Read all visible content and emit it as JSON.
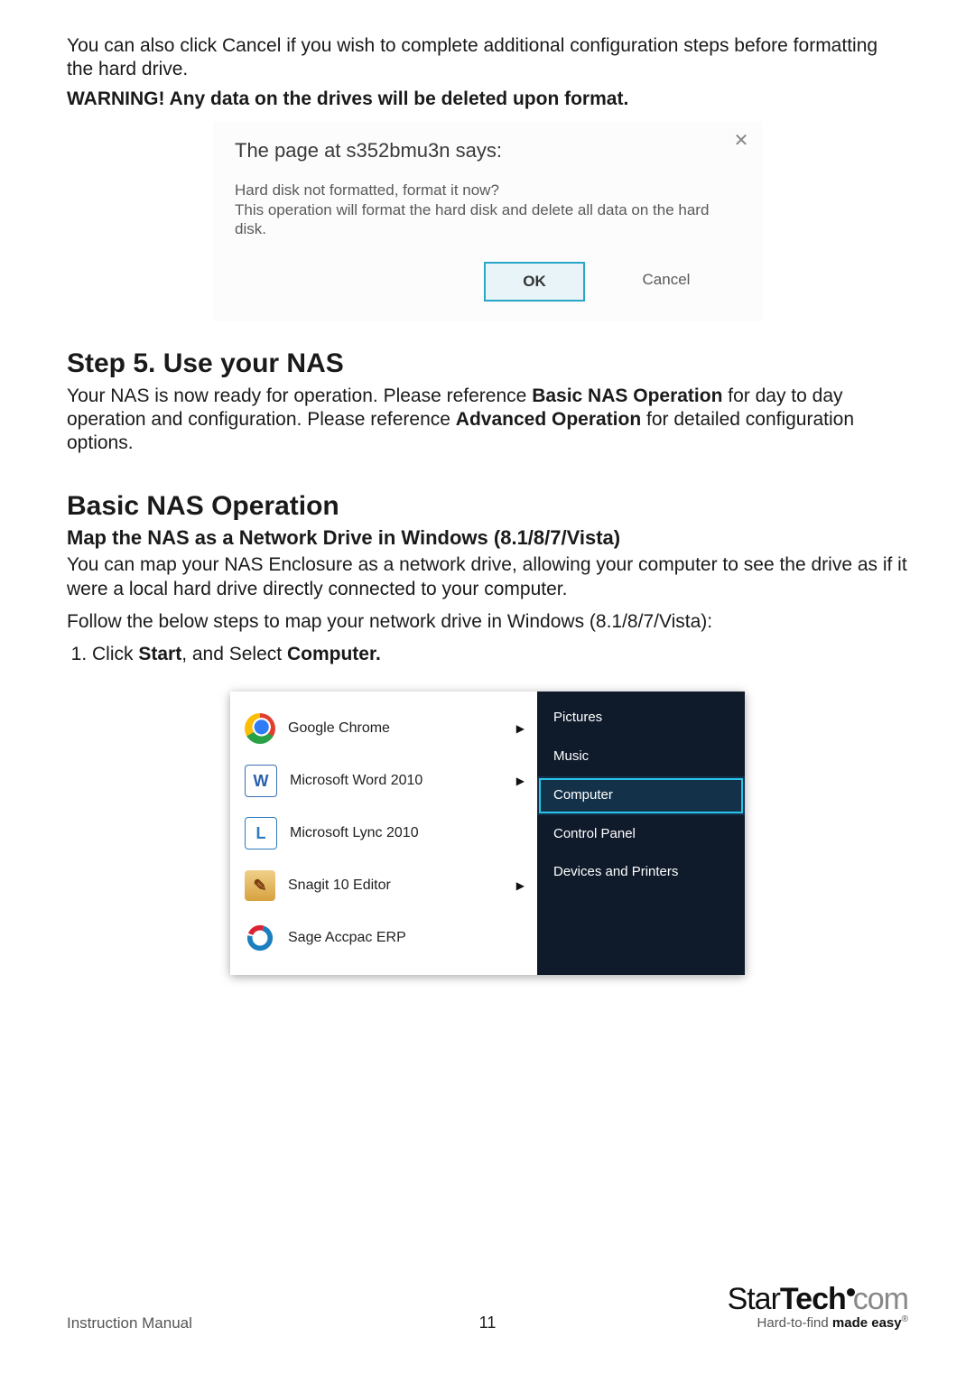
{
  "intro": {
    "para1": "You can also click Cancel if you wish to complete additional configuration steps before formatting the hard drive.",
    "warning": "WARNING! Any data on the drives will be deleted upon format."
  },
  "dialog": {
    "title": "The page at s352bmu3n says:",
    "line1": "Hard disk not formatted, format it now?",
    "line2": " This operation will format the hard disk and delete all data on the hard disk.",
    "ok": "OK",
    "cancel": "Cancel",
    "close_glyph": "✕"
  },
  "step5": {
    "heading": "Step 5. Use your NAS",
    "p1a": "Your NAS is now ready for operation. Please reference ",
    "p1b": "Basic NAS Operation",
    "p1c": " for day to day operation and configuration. Please reference ",
    "p1d": "Advanced Operation",
    "p1e": " for detailed configuration options."
  },
  "basic": {
    "heading": "Basic NAS Operation",
    "sub": "Map the NAS as a Network Drive in Windows (8.1/8/7/Vista)",
    "p1": "You can map your NAS Enclosure as a network drive, allowing your computer to see the drive as if it were a local hard drive directly connected to your computer.",
    "p2": "Follow the below steps to map your network drive in Windows (8.1/8/7/Vista):",
    "li1a": "Click ",
    "li1b": "Start",
    "li1c": ", and Select ",
    "li1d": "Computer."
  },
  "startmenu": {
    "left": [
      {
        "label": "Google Chrome",
        "submenu": true
      },
      {
        "label": "Microsoft Word 2010",
        "submenu": true
      },
      {
        "label": "Microsoft Lync 2010",
        "submenu": false
      },
      {
        "label": "Snagit 10 Editor",
        "submenu": true
      },
      {
        "label": "Sage Accpac ERP",
        "submenu": false
      }
    ],
    "right": [
      {
        "label": "Pictures",
        "selected": false
      },
      {
        "label": "Music",
        "selected": false
      },
      {
        "label": "Computer",
        "selected": true
      },
      {
        "label": "Control Panel",
        "selected": false
      },
      {
        "label": "Devices and Printers",
        "selected": false
      }
    ],
    "arrow": "▶"
  },
  "footer": {
    "left": "Instruction Manual",
    "page": "11",
    "logo_star": "Star",
    "logo_tech": "Tech",
    "logo_com": "com",
    "tag_a": "Hard-to-find ",
    "tag_b": "made easy",
    "reg": "®"
  }
}
